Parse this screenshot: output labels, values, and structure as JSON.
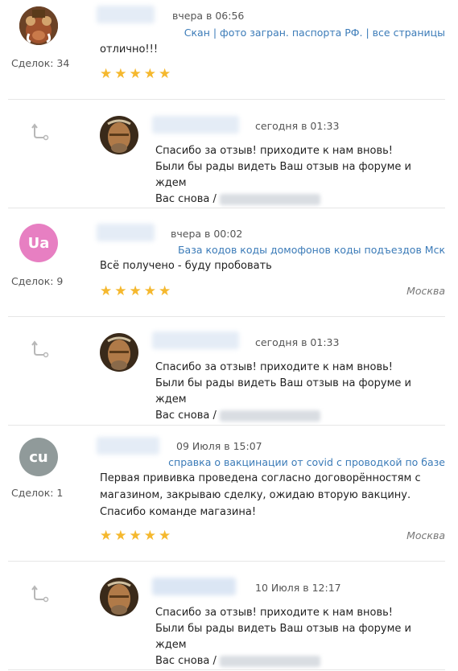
{
  "reviews": [
    {
      "deals": "Сделок: 34",
      "date": "вчера в 06:56",
      "product": "Скан | фото загран. паспорта РФ. | все страницы",
      "text": "отлично!!!",
      "stars": "★★★★★",
      "city": "",
      "avatar_kind": "cartoon-warthog"
    },
    {
      "avatar_initials": "Ua",
      "avatar_color": "#e77fc2",
      "deals": "Сделок: 9",
      "date": "вчера в 00:02",
      "product": "База кодов коды домофонов коды подъездов Мск",
      "text": "Всё получено - буду пробовать",
      "stars": "★★★★★",
      "city": "Москва"
    },
    {
      "avatar_initials": "cu",
      "avatar_color": "#909a9a",
      "deals": "Сделок: 1",
      "date": "09 Июля в 15:07",
      "product": "справка о вакцинации от covid с проводкой по базе",
      "text": "Первая прививка проведена согласно договорённостям с магазином, закрываю сделку, ожидаю вторую вакцину. Спасибо команде магазина!",
      "stars": "★★★★★",
      "city": "Москва"
    }
  ],
  "replies": [
    {
      "date": "сегодня в 01:33",
      "line1": "Спасибо за отзыв! приходите к нам вновь!",
      "line2": "Были бы рады видеть Ваш отзыв на форуме и ждем",
      "line3": "Вас снова /"
    },
    {
      "date": "сегодня в 01:33",
      "line1": "Спасибо за отзыв! приходите к нам вновь!",
      "line2": "Были бы рады видеть Ваш отзыв на форуме и ждем",
      "line3": "Вас снова /"
    },
    {
      "date": "10 Июля в 12:17",
      "line1": "Спасибо за отзыв! приходите к нам вновь!",
      "line2": "Были бы рады видеть Ваш отзыв на форуме и ждем",
      "line3": "Вас снова /"
    }
  ],
  "colors": {
    "link": "#3b7bb8",
    "star": "#f5b82e",
    "separator": "#e6e6e6"
  },
  "icons": {
    "reply": "reply-arrow-icon"
  }
}
